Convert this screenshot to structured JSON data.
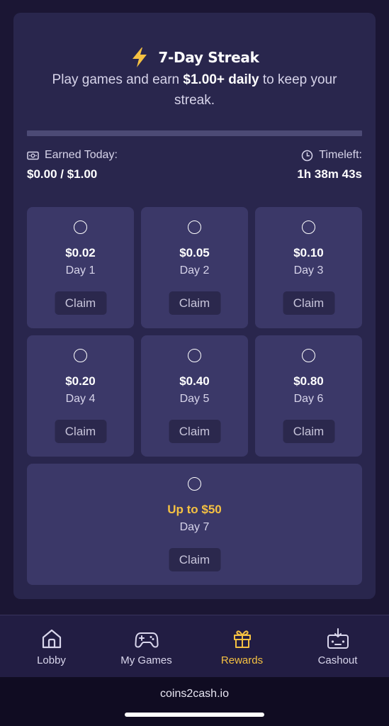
{
  "streak": {
    "title": "7-Day Streak",
    "subtitle_before": "Play games and earn ",
    "subtitle_bold": "$1.00+ daily",
    "subtitle_after": " to keep your streak.",
    "progress_fraction": 0.0,
    "earned_label": "Earned Today:",
    "earned_value": "$0.00 / $1.00",
    "time_label": "Timeleft:",
    "time_value": "1h 38m 43s"
  },
  "days": [
    {
      "amount": "$0.02",
      "day": "Day 1",
      "claim": "Claim"
    },
    {
      "amount": "$0.05",
      "day": "Day 2",
      "claim": "Claim"
    },
    {
      "amount": "$0.10",
      "day": "Day 3",
      "claim": "Claim"
    },
    {
      "amount": "$0.20",
      "day": "Day 4",
      "claim": "Claim"
    },
    {
      "amount": "$0.40",
      "day": "Day 5",
      "claim": "Claim"
    },
    {
      "amount": "$0.80",
      "day": "Day 6",
      "claim": "Claim"
    },
    {
      "amount": "Up to $50",
      "day": "Day 7",
      "claim": "Claim"
    }
  ],
  "nav": [
    {
      "label": "Lobby",
      "icon": "home-icon",
      "active": false
    },
    {
      "label": "My Games",
      "icon": "gamepad-icon",
      "active": false
    },
    {
      "label": "Rewards",
      "icon": "gift-icon",
      "active": true
    },
    {
      "label": "Cashout",
      "icon": "cashout-icon",
      "active": false
    }
  ],
  "footer": {
    "url": "coins2cash.io"
  },
  "colors": {
    "accent_gold": "#f5c142",
    "card_bg": "#29264d",
    "tile_bg": "#3b3868",
    "page_bg": "#1b1634"
  }
}
